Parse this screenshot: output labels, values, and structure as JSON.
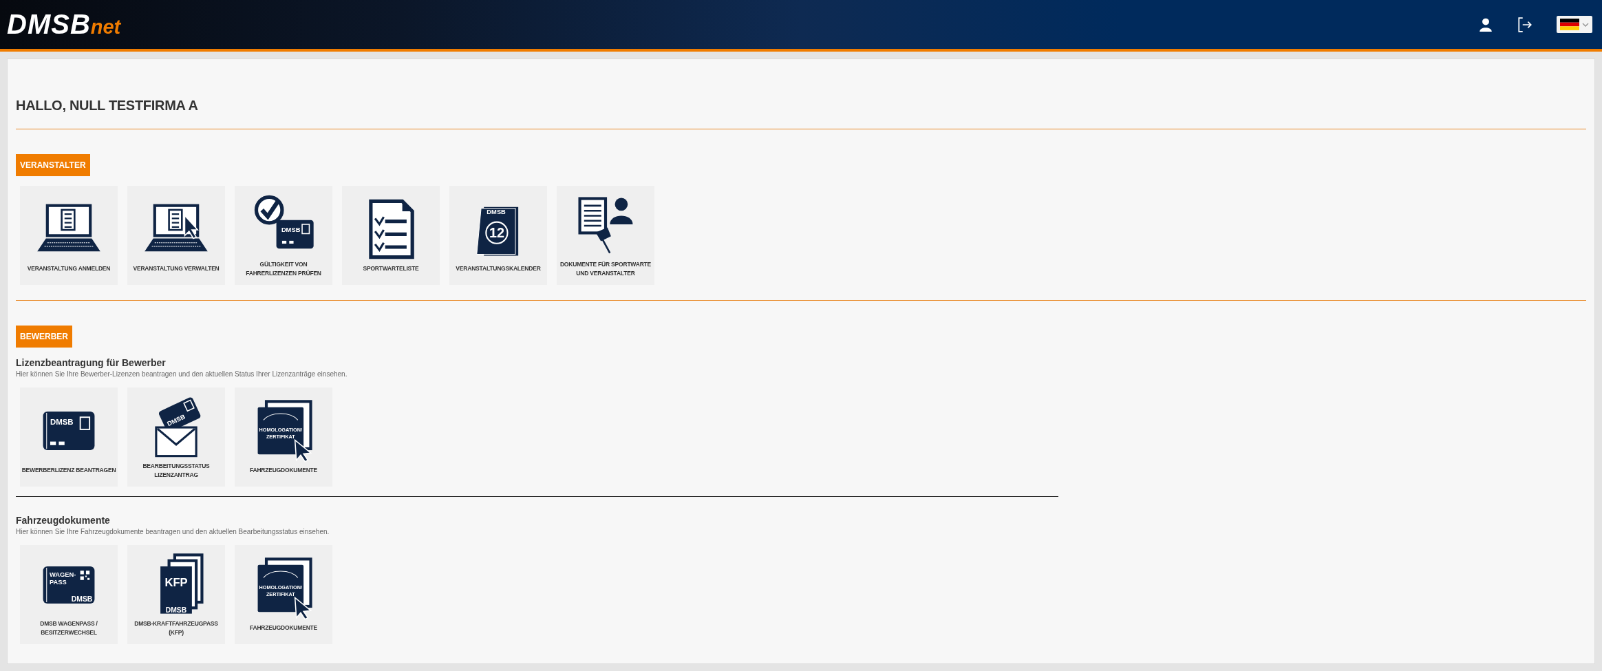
{
  "header": {
    "logo": {
      "main": "DMSB",
      "suffix": "net"
    }
  },
  "greeting": "HALLO, NULL TESTFIRMA A",
  "sections": [
    {
      "badge": "VERANSTALTER",
      "groups": [
        {
          "tiles": [
            {
              "label": "VERANSTALTUNG ANMELDEN",
              "kind": "laptop-list"
            },
            {
              "label": "VERANSTALTUNG VERWALTEN",
              "kind": "laptop-cursor"
            },
            {
              "label": "GÜLTIGKEIT VON FAHRERLIZENZEN PRÜFEN",
              "kind": "check-card",
              "icon_text": [
                "DMSB"
              ]
            },
            {
              "label": "SPORTWARTELISTE",
              "kind": "checklist"
            },
            {
              "label": "VERANSTALTUNGSKALENDER",
              "kind": "calendar",
              "icon_text": [
                "DMSB",
                "12"
              ]
            },
            {
              "label": "DOKUMENTE FÜR SPORTWARTE UND VERANSTALTER",
              "kind": "docs-person"
            }
          ]
        }
      ]
    },
    {
      "badge": "BEWERBER",
      "groups": [
        {
          "title": "Lizenzbeantragung für Bewerber",
          "description": "Hier können Sie Ihre Bewerber-Lizenzen beantragen und den aktuellen Status Ihrer Lizenzanträge einsehen.",
          "tiles": [
            {
              "label": "BEWERBERLIZENZ BEANTRAGEN",
              "kind": "card",
              "icon_text": [
                "DMSB"
              ]
            },
            {
              "label": "BEARBEITUNGSSTATUS LIZENZANTRAG",
              "kind": "card-envelope",
              "icon_text": [
                "DMSB"
              ]
            },
            {
              "label": "FAHRZEUGDOKUMENTE",
              "kind": "docs-cursor",
              "icon_text": [
                "HOMOLOGATION/",
                "ZERTIFIKAT"
              ]
            }
          ]
        },
        {
          "title": "Fahrzeugdokumente",
          "description": "Hier können Sie Ihre Fahrzeugdokumente beantragen und den aktuellen Bearbeitungsstatus einsehen.",
          "tiles": [
            {
              "label": "DMSB WAGENPASS / BESITZERWECHSEL",
              "kind": "wagenpass",
              "icon_text": [
                "WAGEN-",
                "PASS",
                "DMSB"
              ]
            },
            {
              "label": "DMSB-KRAFTFAHRZEUGPASS (KFP)",
              "kind": "kfp",
              "icon_text": [
                "KFP",
                "DMSB"
              ]
            },
            {
              "label": "FAHRZEUGDOKUMENTE",
              "kind": "docs-cursor",
              "icon_text": [
                "HOMOLOGATION/",
                "ZERTIFIKAT"
              ]
            }
          ]
        }
      ]
    }
  ]
}
